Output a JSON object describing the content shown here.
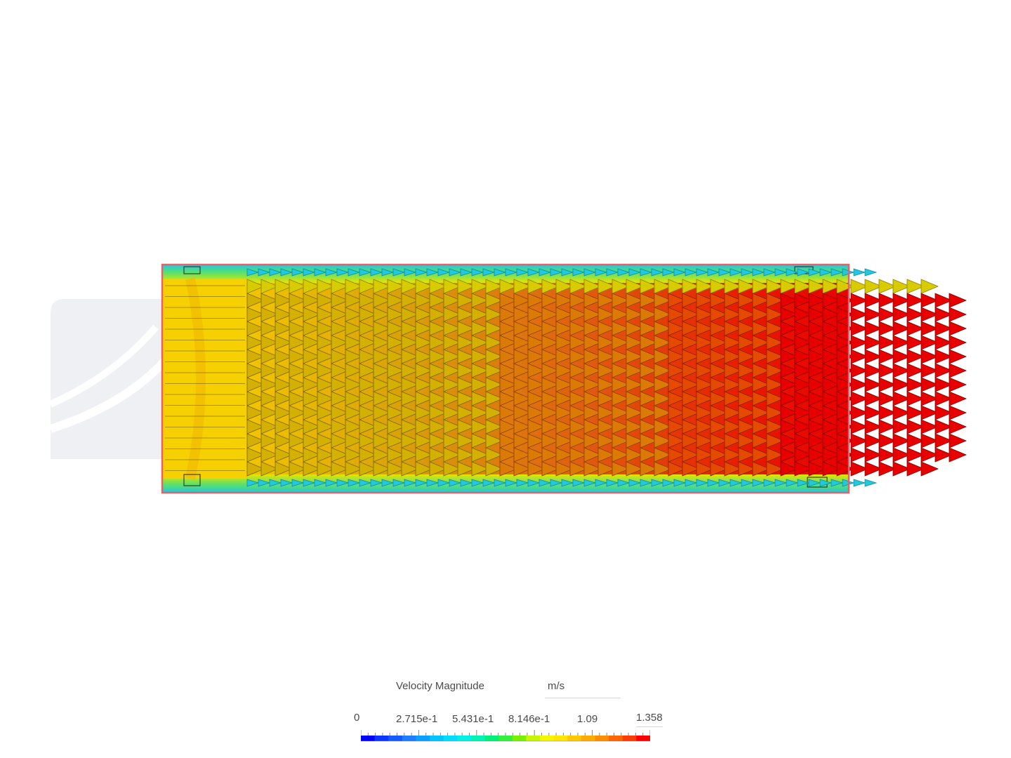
{
  "legend": {
    "title": "Velocity Magnitude",
    "unit": "m/s",
    "tick_labels": [
      "0",
      "2.715e-1",
      "5.431e-1",
      "8.146e-1",
      "1.09",
      "1.358"
    ],
    "min": 0,
    "max": 1.358,
    "colors": [
      "#0000ff",
      "#0a37ff",
      "#145aff",
      "#1e7dff",
      "#0aa0ff",
      "#00c3ff",
      "#00dcff",
      "#00f0e6",
      "#00f5b4",
      "#00f078",
      "#32f03c",
      "#78f000",
      "#c8f500",
      "#f5f500",
      "#ffe600",
      "#ffc800",
      "#ffaa00",
      "#ff8c00",
      "#ff6400",
      "#ff3c00",
      "#ff0000"
    ]
  },
  "colors": {
    "domain_outline": "#e8606a",
    "field_yellow": "#f5d400",
    "field_orange": "#e07a10",
    "field_red": "#e80000",
    "boundary_cyan": "#2ed4e8",
    "watermark": "#eef0f3"
  }
}
